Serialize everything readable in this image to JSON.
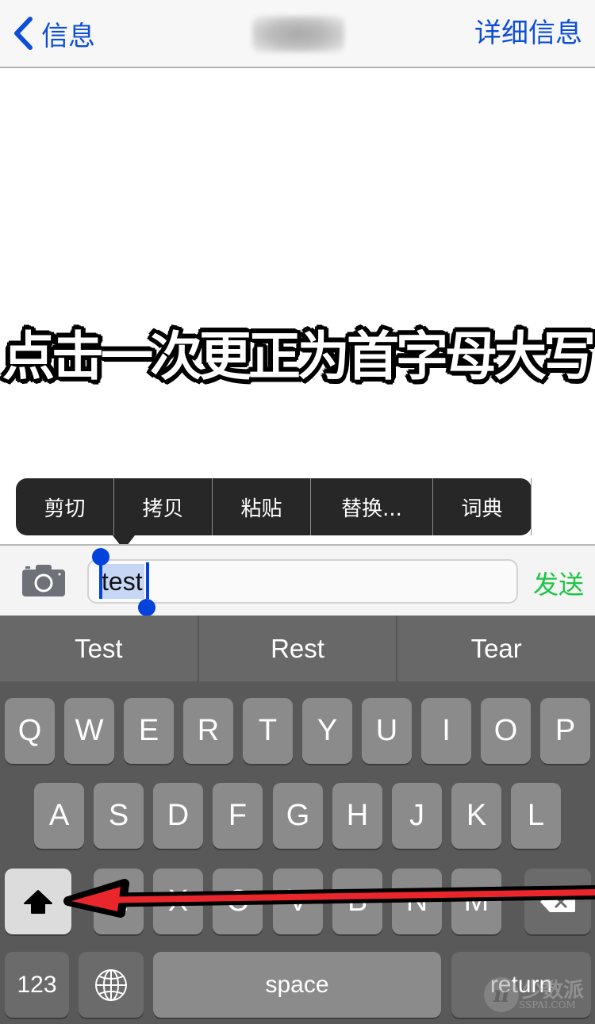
{
  "navbar": {
    "back_label": "信息",
    "title_blurred": true,
    "details_label": "详细信息"
  },
  "annotation": {
    "text": "点击一次更正为首字母大写"
  },
  "edit_menu": {
    "items": [
      "剪切",
      "拷贝",
      "粘贴",
      "替换...",
      "词典"
    ]
  },
  "compose": {
    "text_value": "test",
    "selected_text": "test",
    "send_label": "发送"
  },
  "keyboard": {
    "suggestions": [
      "Test",
      "Rest",
      "Tear"
    ],
    "row1": [
      "Q",
      "W",
      "E",
      "R",
      "T",
      "Y",
      "U",
      "I",
      "O",
      "P"
    ],
    "row2": [
      "A",
      "S",
      "D",
      "F",
      "G",
      "H",
      "J",
      "K",
      "L"
    ],
    "row3": [
      "Z",
      "X",
      "C",
      "V",
      "B",
      "N",
      "M"
    ],
    "numbers_label": "123",
    "space_label": "space",
    "return_label": "return",
    "shift_active": true
  },
  "colors": {
    "ios_blue": "#0d4ed8",
    "send_green": "#1ec445",
    "selection_handle": "#0343dc",
    "arrow_red": "#e8262b"
  },
  "watermark": {
    "brand_cn": "少数派",
    "brand_en": "SSPAI.COM"
  }
}
